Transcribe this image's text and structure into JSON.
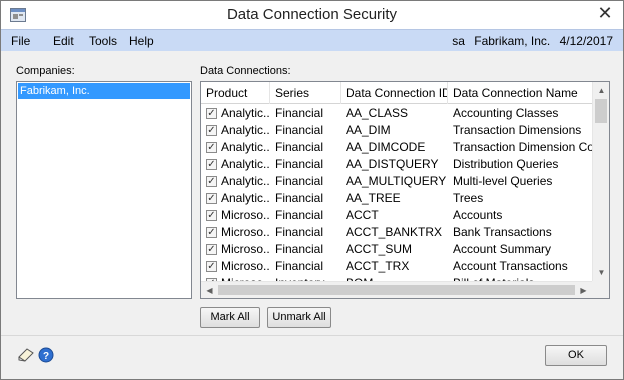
{
  "window": {
    "title": "Data Connection Security",
    "close_glyph": "✕"
  },
  "menu": {
    "items": [
      "File",
      "Edit",
      "Tools",
      "Help"
    ],
    "status": {
      "user": "sa",
      "company": "Fabrikam, Inc.",
      "date": "4/12/2017"
    }
  },
  "companies": {
    "label": "Companies:",
    "items": [
      "Fabrikam, Inc."
    ],
    "selected": "Fabrikam, Inc."
  },
  "connections": {
    "label": "Data Connections:",
    "columns": [
      "Product",
      "Series",
      "Data Connection ID",
      "Data Connection Name"
    ],
    "rows": [
      {
        "checked": true,
        "product": "Analytic...",
        "series": "Financial",
        "id": "AA_CLASS",
        "name": "Accounting Classes"
      },
      {
        "checked": true,
        "product": "Analytic...",
        "series": "Financial",
        "id": "AA_DIM",
        "name": "Transaction Dimensions"
      },
      {
        "checked": true,
        "product": "Analytic...",
        "series": "Financial",
        "id": "AA_DIMCODE",
        "name": "Transaction Dimension Codes"
      },
      {
        "checked": true,
        "product": "Analytic...",
        "series": "Financial",
        "id": "AA_DISTQUERY",
        "name": "Distribution Queries"
      },
      {
        "checked": true,
        "product": "Analytic...",
        "series": "Financial",
        "id": "AA_MULTIQUERY",
        "name": "Multi-level Queries"
      },
      {
        "checked": true,
        "product": "Analytic...",
        "series": "Financial",
        "id": "AA_TREE",
        "name": "Trees"
      },
      {
        "checked": true,
        "product": "Microso...",
        "series": "Financial",
        "id": "ACCT",
        "name": "Accounts"
      },
      {
        "checked": true,
        "product": "Microso...",
        "series": "Financial",
        "id": "ACCT_BANKTRX",
        "name": "Bank Transactions"
      },
      {
        "checked": true,
        "product": "Microso...",
        "series": "Financial",
        "id": "ACCT_SUM",
        "name": "Account Summary"
      },
      {
        "checked": true,
        "product": "Microso...",
        "series": "Financial",
        "id": "ACCT_TRX",
        "name": "Account Transactions"
      },
      {
        "checked": true,
        "product": "Microso...",
        "series": "Inventory",
        "id": "BOM",
        "name": "Bill of Materials"
      }
    ]
  },
  "buttons": {
    "mark_all": "Mark All",
    "unmark_all": "Unmark All",
    "ok": "OK"
  },
  "icons": {
    "app": "app-window-icon",
    "note": "note-icon",
    "help": "help-icon"
  }
}
